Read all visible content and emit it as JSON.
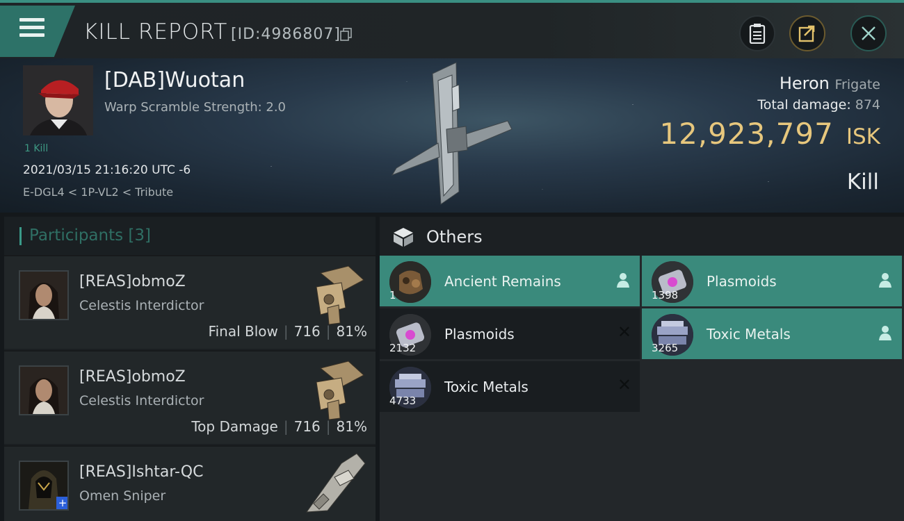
{
  "header": {
    "title": "KILL REPORT",
    "report_id": "[ID:4986807]"
  },
  "victim": {
    "name": "[DAB]Wuotan",
    "subtitle": "Warp Scramble Strength: 2.0",
    "kill_tag": "1 Kill",
    "datetime": "2021/03/15 21:16:20 UTC -6",
    "location": "E-DGL4 < 1P-VL2 < Tribute",
    "ship_name": "Heron",
    "ship_class": "Frigate",
    "total_damage_label": "Total damage:",
    "total_damage": "874",
    "isk_value": "12,923,797",
    "isk_unit": "ISK",
    "result": "Kill"
  },
  "participants": {
    "label": "Participants",
    "count": "[3]",
    "rows": [
      {
        "name": "[REAS]obmoZ",
        "ship": "Celestis Interdictor",
        "role": "Final Blow",
        "damage": "716",
        "percent": "81%"
      },
      {
        "name": "[REAS]obmoZ",
        "ship": "Celestis Interdictor",
        "role": "Top Damage",
        "damage": "716",
        "percent": "81%"
      },
      {
        "name": "[REAS]Ishtar-QC",
        "ship": "Omen Sniper",
        "role": "",
        "damage": "",
        "percent": ""
      }
    ]
  },
  "others": {
    "title": "Others",
    "items": [
      {
        "name": "Ancient Remains",
        "qty": "1",
        "status": "dropped"
      },
      {
        "name": "Plasmoids",
        "qty": "1398",
        "status": "dropped"
      },
      {
        "name": "Plasmoids",
        "qty": "2132",
        "status": "destroyed"
      },
      {
        "name": "Toxic Metals",
        "qty": "3265",
        "status": "dropped"
      },
      {
        "name": "Toxic Metals",
        "qty": "4733",
        "status": "destroyed"
      }
    ]
  },
  "colors": {
    "accent": "#3a8a7c",
    "isk": "#e7c77d",
    "panel": "#222729"
  }
}
